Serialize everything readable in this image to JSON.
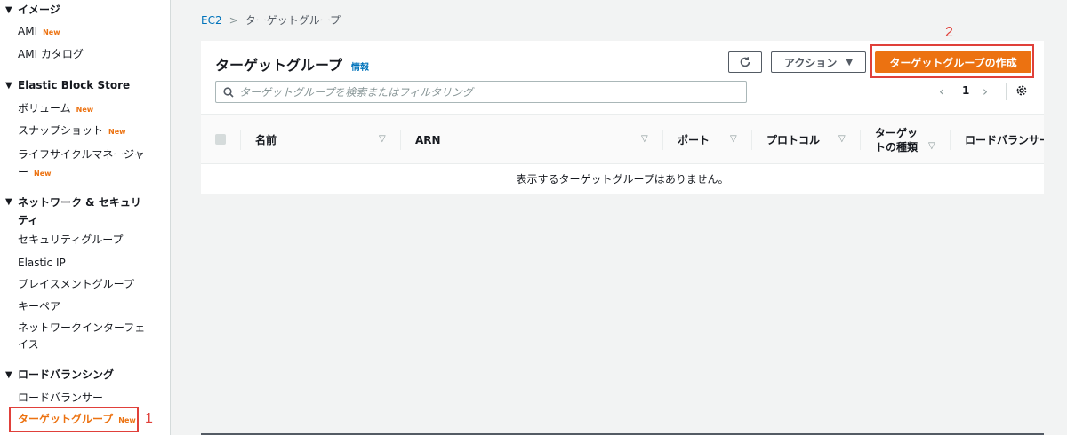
{
  "sidebar": {
    "images_section": "イメージ",
    "ami": "AMI",
    "ami_catalog": "AMI カタログ",
    "ebs_section": "Elastic Block Store",
    "volumes": "ボリューム",
    "snapshots": "スナップショット",
    "lifecycle_manager": "ライフサイクルマネージャー",
    "network_section": "ネットワーク & セキュリティ",
    "security_groups": "セキュリティグループ",
    "elastic_ip": "Elastic IP",
    "placement_groups": "プレイスメントグループ",
    "key_pairs": "キーペア",
    "network_interfaces": "ネットワークインターフェイス",
    "lb_section": "ロードバランシング",
    "load_balancers": "ロードバランサー",
    "target_groups": "ターゲットグループ",
    "new_badge": "New"
  },
  "annotations": {
    "one": "1",
    "two": "2"
  },
  "breadcrumb": {
    "root": "EC2",
    "current": "ターゲットグループ"
  },
  "panel": {
    "title": "ターゲットグループ",
    "info": "情報",
    "actions": "アクション",
    "create": "ターゲットグループの作成",
    "search_placeholder": "ターゲットグループを検索またはフィルタリング",
    "page": "1",
    "columns": [
      "名前",
      "ARN",
      "ポート",
      "プロトコル",
      "ターゲットの種類",
      "ロードバランサー"
    ],
    "empty_message": "表示するターゲットグループはありません。"
  },
  "colors": {
    "accent": "#ec7211",
    "link": "#0073bb",
    "annotation": "#e0403a"
  },
  "icons": {
    "refresh": "refresh-icon",
    "search": "search-icon",
    "settings": "gear-icon"
  }
}
